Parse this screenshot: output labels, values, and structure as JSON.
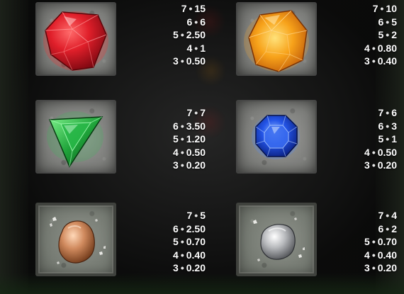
{
  "symbols": [
    {
      "name": "red-gem",
      "color": "#d9222a",
      "pays": [
        {
          "count": "7",
          "value": "15"
        },
        {
          "count": "6",
          "value": "6"
        },
        {
          "count": "5",
          "value": "2.50"
        },
        {
          "count": "4",
          "value": "1"
        },
        {
          "count": "3",
          "value": "0.50"
        }
      ]
    },
    {
      "name": "orange-gem",
      "color": "#f49a17",
      "pays": [
        {
          "count": "7",
          "value": "10"
        },
        {
          "count": "6",
          "value": "5"
        },
        {
          "count": "5",
          "value": "2"
        },
        {
          "count": "4",
          "value": "0.80"
        },
        {
          "count": "3",
          "value": "0.40"
        }
      ]
    },
    {
      "name": "green-gem",
      "color": "#1f9a35",
      "pays": [
        {
          "count": "7",
          "value": "7"
        },
        {
          "count": "6",
          "value": "3.50"
        },
        {
          "count": "5",
          "value": "1.20"
        },
        {
          "count": "4",
          "value": "0.50"
        },
        {
          "count": "3",
          "value": "0.20"
        }
      ]
    },
    {
      "name": "blue-gem",
      "color": "#1f4fe0",
      "pays": [
        {
          "count": "7",
          "value": "6"
        },
        {
          "count": "6",
          "value": "3"
        },
        {
          "count": "5",
          "value": "1"
        },
        {
          "count": "4",
          "value": "0.50"
        },
        {
          "count": "3",
          "value": "0.20"
        }
      ]
    },
    {
      "name": "copper-nugget",
      "color": "#c98a62",
      "pays": [
        {
          "count": "7",
          "value": "5"
        },
        {
          "count": "6",
          "value": "2.50"
        },
        {
          "count": "5",
          "value": "0.70"
        },
        {
          "count": "4",
          "value": "0.40"
        },
        {
          "count": "3",
          "value": "0.20"
        }
      ]
    },
    {
      "name": "silver-nugget",
      "color": "#c9cacc",
      "pays": [
        {
          "count": "7",
          "value": "4"
        },
        {
          "count": "6",
          "value": "2"
        },
        {
          "count": "5",
          "value": "0.70"
        },
        {
          "count": "4",
          "value": "0.40"
        },
        {
          "count": "3",
          "value": "0.20"
        }
      ]
    }
  ],
  "separator": "•"
}
